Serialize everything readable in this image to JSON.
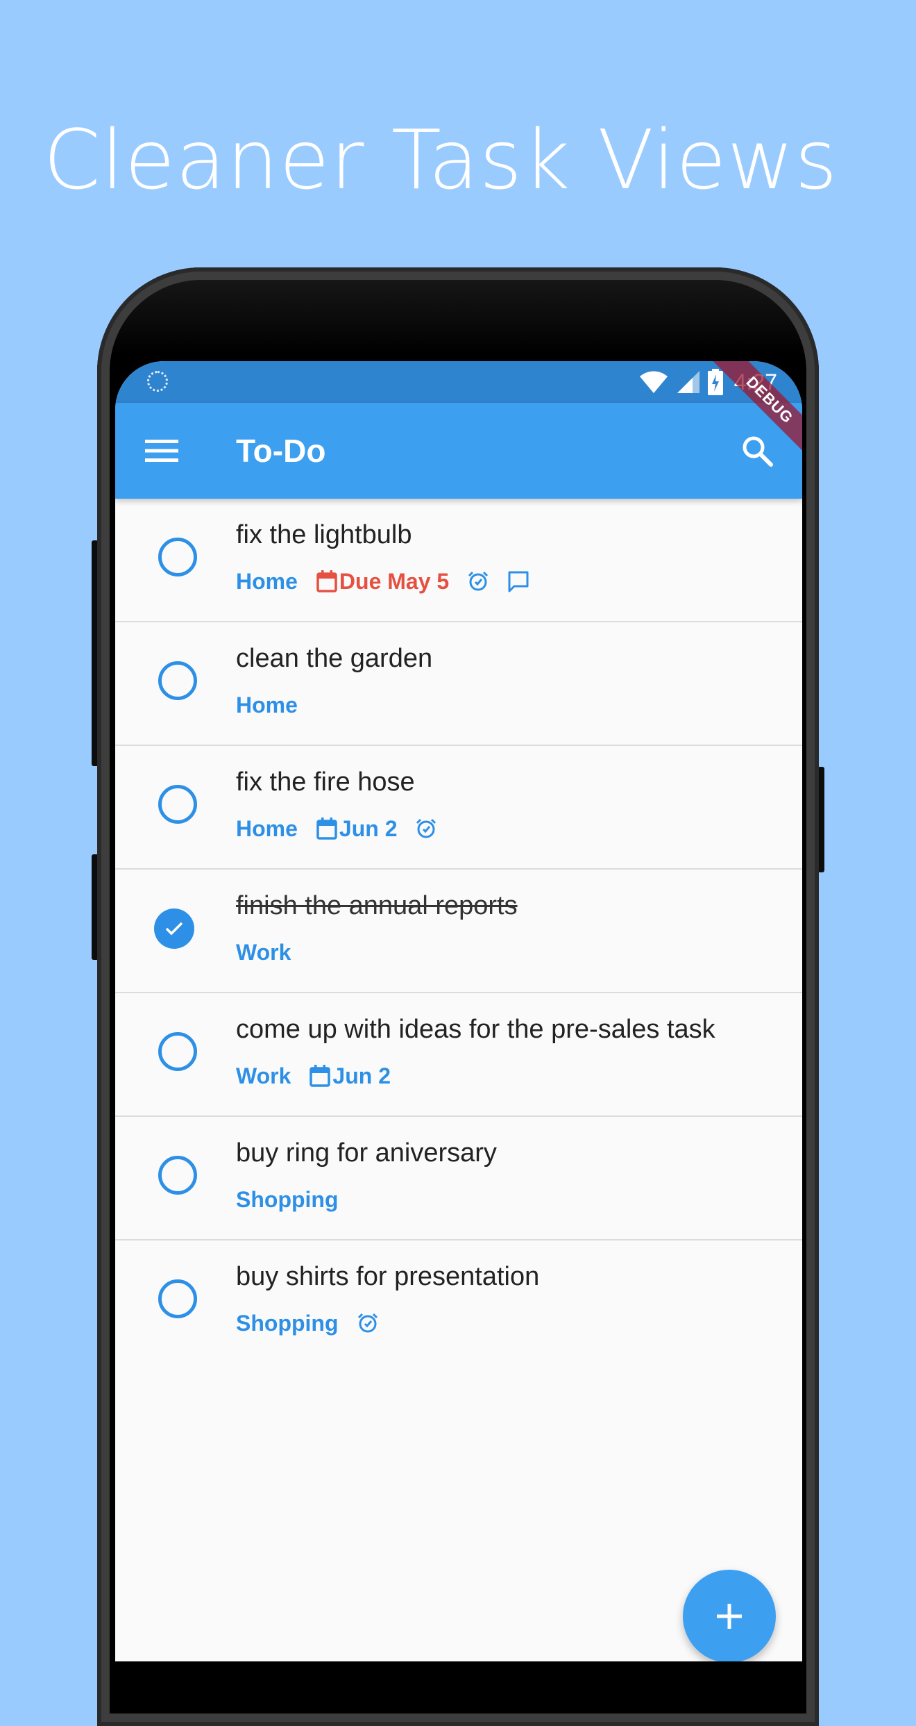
{
  "promo": {
    "title": "Cleaner Task Views"
  },
  "status_bar": {
    "time": "4:27",
    "icons": [
      "sync-icon",
      "wifi-icon",
      "signal-icon",
      "battery-charging-icon"
    ]
  },
  "debug_banner": "DEBUG",
  "app_bar": {
    "title": "To-Do",
    "menu_icon": "hamburger-menu-icon",
    "search_icon": "search-icon"
  },
  "tasks": [
    {
      "title": "fix the lightbulb",
      "category": "Home",
      "due": "Due May 5",
      "due_overdue": true,
      "reminder": true,
      "note": true,
      "completed": false
    },
    {
      "title": "clean the garden",
      "category": "Home",
      "completed": false
    },
    {
      "title": "fix the fire hose",
      "category": "Home",
      "due": "Jun 2",
      "reminder": true,
      "completed": false
    },
    {
      "title": "finish the annual reports",
      "category": "Work",
      "completed": true
    },
    {
      "title": "come up with ideas for the pre-sales task",
      "category": "Work",
      "due": "Jun 2",
      "completed": false
    },
    {
      "title": "buy ring for aniversary",
      "category": "Shopping",
      "completed": false
    },
    {
      "title": "buy shirts for presentation",
      "category": "Shopping",
      "reminder": true,
      "completed": false
    }
  ],
  "fab": {
    "icon": "plus-icon"
  },
  "colors": {
    "background": "#99CBFF",
    "primary": "#3C9FF0",
    "status_bar": "#2F84CF",
    "accent": "#2D90E6",
    "overdue": "#E55041"
  }
}
